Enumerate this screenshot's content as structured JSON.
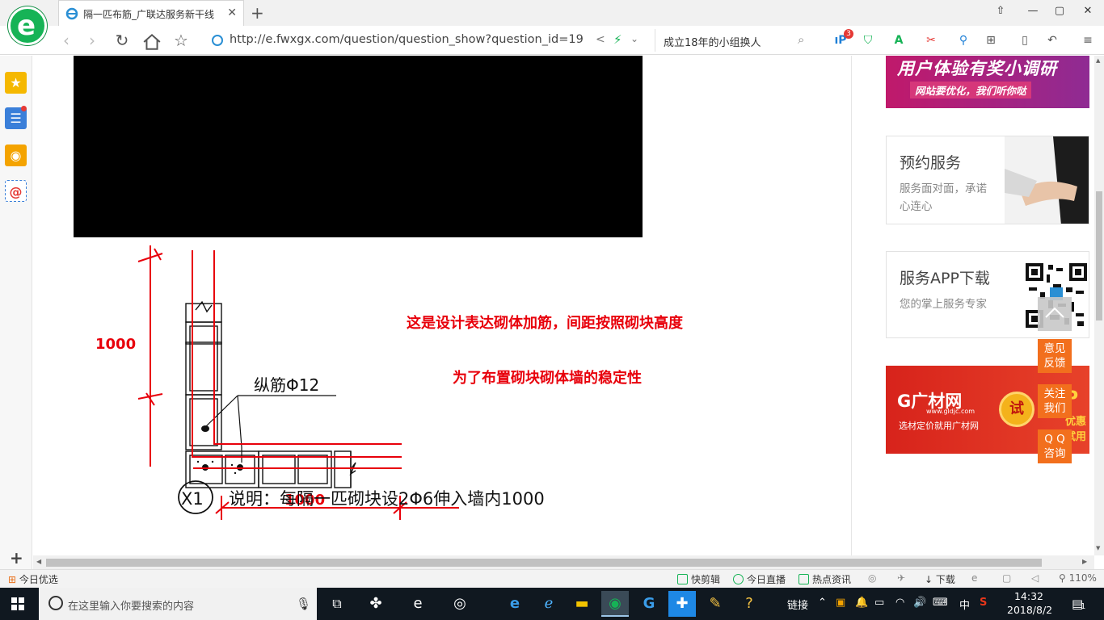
{
  "tab": {
    "title": "隔一匹布筋_广联达服务新干线"
  },
  "window": {
    "minimize": "—",
    "maximize": "▢",
    "close": "✕",
    "pin": "⇧"
  },
  "toolbar": {
    "url": "http://e.fwxgx.com/question/question_show?question_id=19",
    "search_text": "成立18年的小组换人",
    "ext_badge": "3"
  },
  "drawing": {
    "rebar_label": "纵筋Φ12",
    "dim_vertical": "1000",
    "dim_horizontal": "1000",
    "annotation_1": "这是设计表达砌体加筋，间距按照砌块高度",
    "annotation_2": "为了布置砌块砌体墙的稳定性",
    "detail_mark": "X1",
    "note": "说明：每隔一匹砌块设2Φ6伸入墙内1000"
  },
  "right": {
    "banner_top": {
      "line1": "用户体验有奖小调研",
      "line2": "网站要优化，我们听你哒"
    },
    "card_service": {
      "title": "预约服务",
      "desc": "服务面对面，承诺心连心"
    },
    "card_app": {
      "title": "服务APP下载",
      "desc": "您的掌上服务专家"
    },
    "gcw": {
      "logo": "G广材网",
      "url": "www.gldjc.com",
      "slogan": "选材定价就用广材网",
      "try": "试",
      "right1": "P",
      "right2": "优惠试用"
    }
  },
  "float": {
    "feedback": "意见\n反馈",
    "follow": "关注\n我们",
    "qq": "Q Q\n咨询"
  },
  "statusbar": {
    "left": "今日优选",
    "quick_clip": "快剪辑",
    "live": "今日直播",
    "hot_news": "热点资讯",
    "download": "下载",
    "zoom": "110%"
  },
  "taskbar": {
    "search_placeholder": "在这里输入你要搜索的内容",
    "links": "链接",
    "ime": "中",
    "time": "14:32",
    "date": "2018/8/2",
    "notify_count": "1"
  },
  "colors": {
    "accent_green": "#16b356",
    "annotation_red": "#e8000b",
    "float_orange": "#f26f1d"
  }
}
